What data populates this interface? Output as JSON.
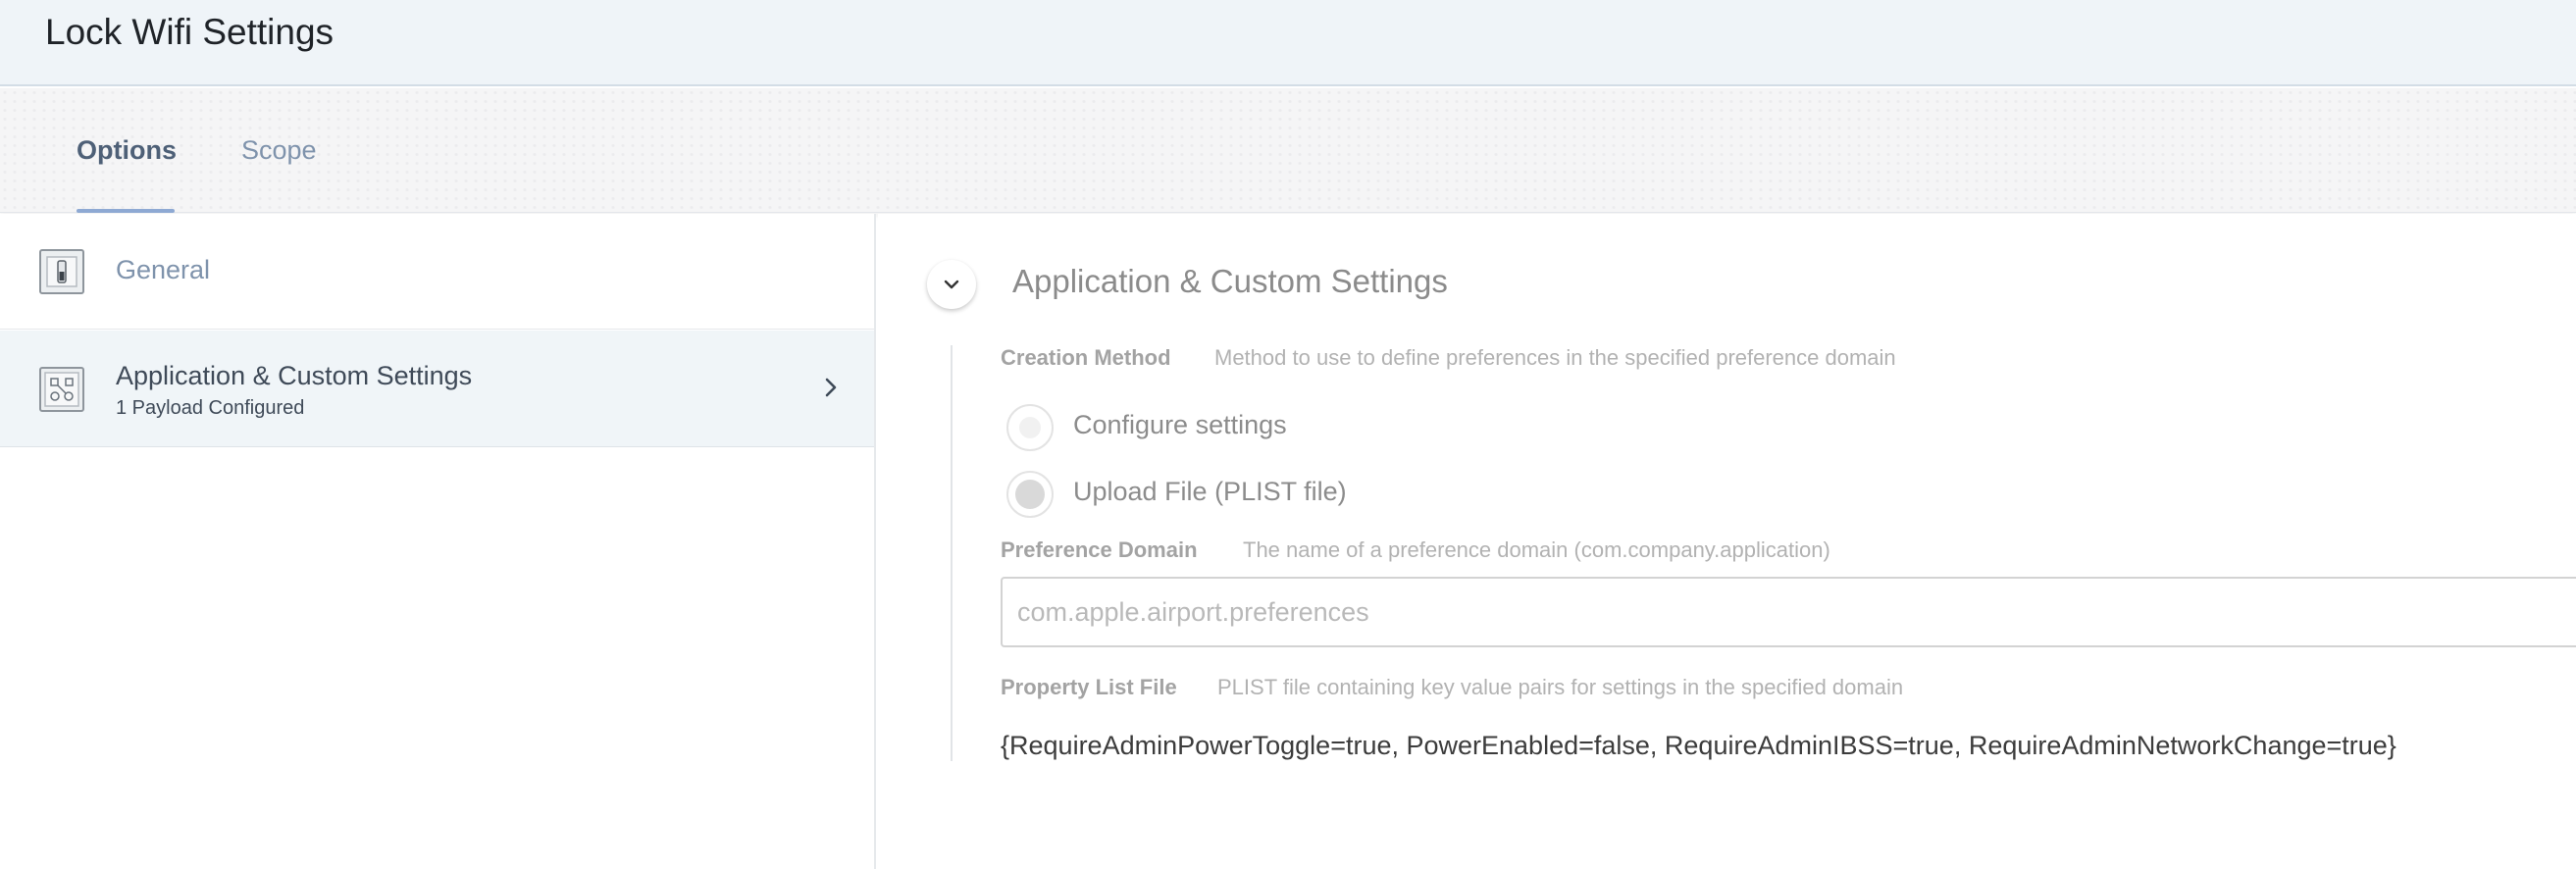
{
  "window": {
    "title": "Lock Wifi Settings"
  },
  "tabs": [
    {
      "label": "Options",
      "active": true
    },
    {
      "label": "Scope",
      "active": false
    }
  ],
  "sidebar": {
    "items": [
      {
        "label": "General",
        "icon": "switch-icon"
      },
      {
        "label": "Application & Custom Settings",
        "sublabel": "1 Payload Configured",
        "icon": "app-settings-icon",
        "selected": true
      }
    ]
  },
  "main": {
    "section_title": "Application & Custom Settings",
    "creation_method": {
      "label": "Creation Method",
      "description": "Method to use to define preferences in the specified preference domain",
      "options": [
        {
          "label": "Configure settings",
          "selected": false
        },
        {
          "label": "Upload File (PLIST file)",
          "selected": true
        }
      ]
    },
    "preference_domain": {
      "label": "Preference Domain",
      "description": "The name of a preference domain (com.company.application)",
      "placeholder": "com.apple.airport.preferences",
      "value": ""
    },
    "property_list": {
      "label": "Property List File",
      "description": "PLIST file containing key value pairs for settings in the specified domain",
      "value": "{RequireAdminPowerToggle=true, PowerEnabled=false, RequireAdminIBSS=true, RequireAdminNetworkChange=true}"
    }
  },
  "colors": {
    "header_bg": "#eff4f8",
    "tab_underline": "#8ea9d3",
    "selected_row_bg": "#f0f5f8",
    "muted_text": "#7f93ac"
  }
}
